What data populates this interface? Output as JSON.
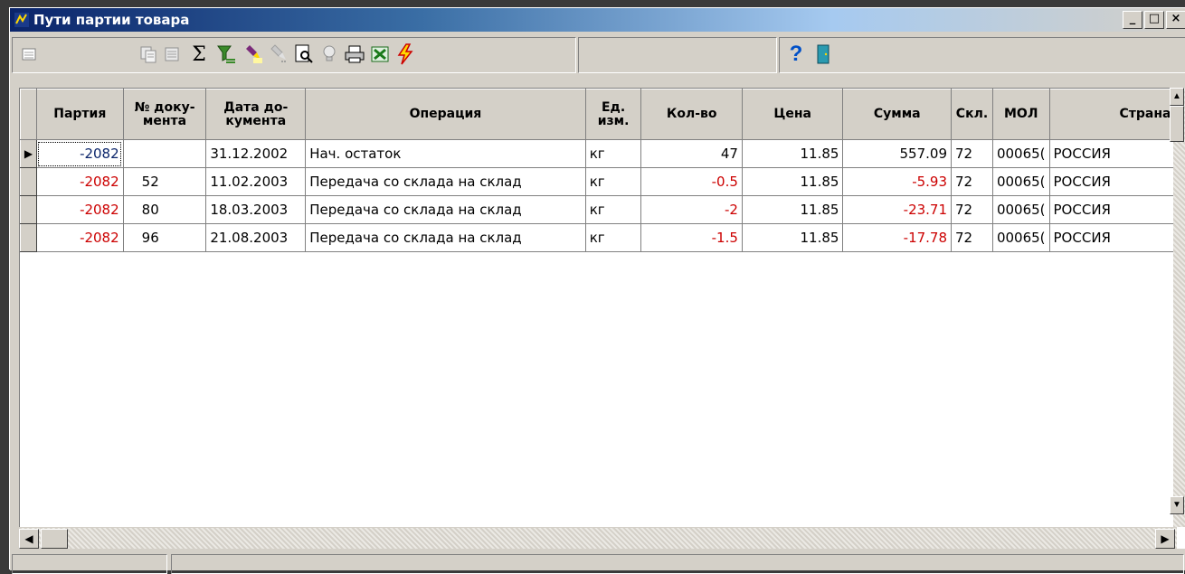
{
  "window": {
    "title": "Пути партии товара",
    "minimize_label": "_",
    "restore_label": "□",
    "close_label": "×"
  },
  "toolbar": {
    "icons": [
      "grid-view-icon",
      "copy-record-icon",
      "paste-record-icon",
      "sum-icon",
      "filter-icon",
      "highlight-icon",
      "highlight-off-icon",
      "preview-icon",
      "hint-icon",
      "print-icon",
      "excel-icon",
      "lightning-icon",
      "help-icon",
      "exit-door-icon"
    ],
    "sum_symbol": "Σ",
    "help_symbol": "?"
  },
  "table": {
    "headers": [
      "Партия",
      "№ доку-\nмента",
      "Дата до-\nкумента",
      "Операция",
      "Ед.\nизм.",
      "Кол-во",
      "Цена",
      "Сумма",
      "Скл.",
      "МОЛ",
      "Страна п"
    ],
    "rows": [
      [
        "-2082",
        "",
        "31.12.2002",
        "Нач. остаток",
        "кг",
        "47",
        "11.85",
        "557.09",
        "72",
        "00065(",
        "РОССИЯ"
      ],
      [
        "-2082",
        "52",
        "11.02.2003",
        "Передача со склада на склад",
        "кг",
        "-0.5",
        "11.85",
        "-5.93",
        "72",
        "00065(",
        "РОССИЯ"
      ],
      [
        "-2082",
        "80",
        "18.03.2003",
        "Передача со склада на склад",
        "кг",
        "-2",
        "11.85",
        "-23.71",
        "72",
        "00065(",
        "РОССИЯ"
      ],
      [
        "-2082",
        "96",
        "21.08.2003",
        "Передача со склада на склад",
        "кг",
        "-1.5",
        "11.85",
        "-17.78",
        "72",
        "00065(",
        "РОССИЯ"
      ]
    ],
    "selected_row_marker": "▶"
  },
  "scroll": {
    "left_arrow": "◀",
    "right_arrow": "▶",
    "up_arrow": "▲",
    "down_arrow": "▼"
  },
  "colors": {
    "negative": "#cc0000",
    "title_bar": "#0a246a",
    "face": "#d4d0c8"
  }
}
